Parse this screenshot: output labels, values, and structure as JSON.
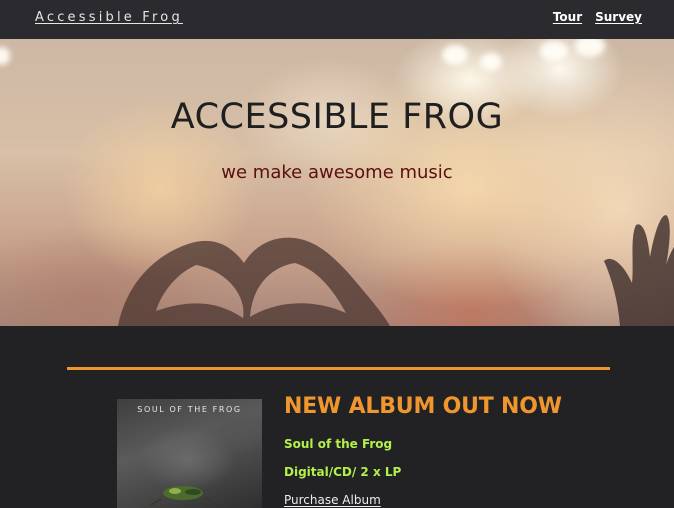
{
  "nav": {
    "brand": "Accessible Frog",
    "links": [
      {
        "label": "Tour"
      },
      {
        "label": "Survey"
      }
    ]
  },
  "hero": {
    "title": "ACCESSIBLE FROG",
    "subtitle": "we make awesome music"
  },
  "album": {
    "cover_title": "SOUL OF THE FROG",
    "heading": "NEW ALBUM OUT NOW",
    "name": "Soul of the Frog",
    "formats": "Digital/CD/ 2 x LP",
    "purchase_label": "Purchase Album"
  },
  "colors": {
    "accent_orange": "#f0962e",
    "highlight_green": "#b3f04a",
    "subtitle_red": "#5a0f10",
    "background": "#222225"
  }
}
